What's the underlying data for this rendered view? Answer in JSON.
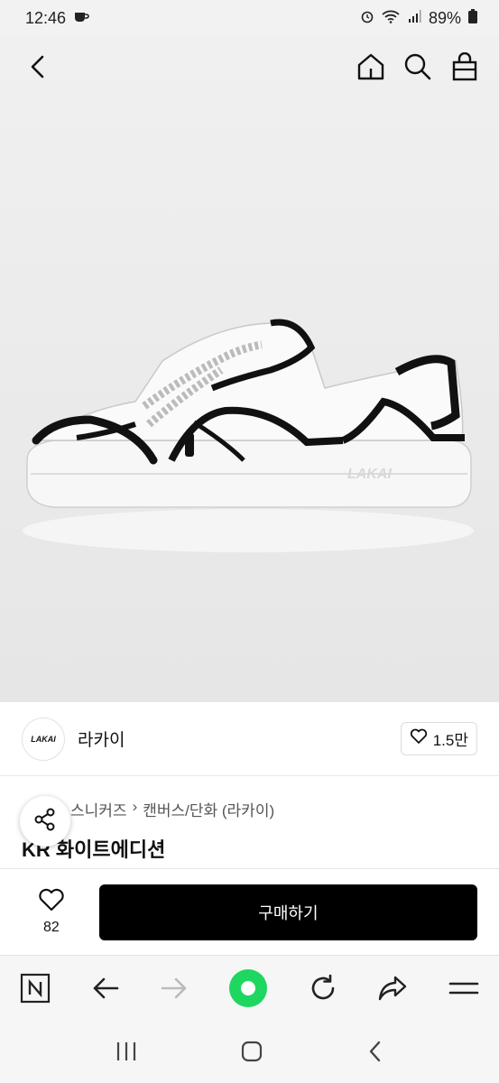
{
  "status_bar": {
    "time": "12:46",
    "battery": "89%"
  },
  "icons": {
    "back": "chevron-left-icon",
    "home": "home-icon",
    "search": "search-icon",
    "cart": "shopping-bag-icon"
  },
  "brand": {
    "logo_text": "LAKAI",
    "name": "라카이",
    "likes": "1.5만"
  },
  "breadcrumb": {
    "items": [
      "스니커즈",
      "캔버스/단화 (라카이)"
    ]
  },
  "product": {
    "title": "KR 화이트에디션"
  },
  "purchase": {
    "wish_count": "82",
    "buy_label": "구매하기"
  },
  "colors": {
    "buy_button": "#000000",
    "record_accent": "#1ed760"
  }
}
